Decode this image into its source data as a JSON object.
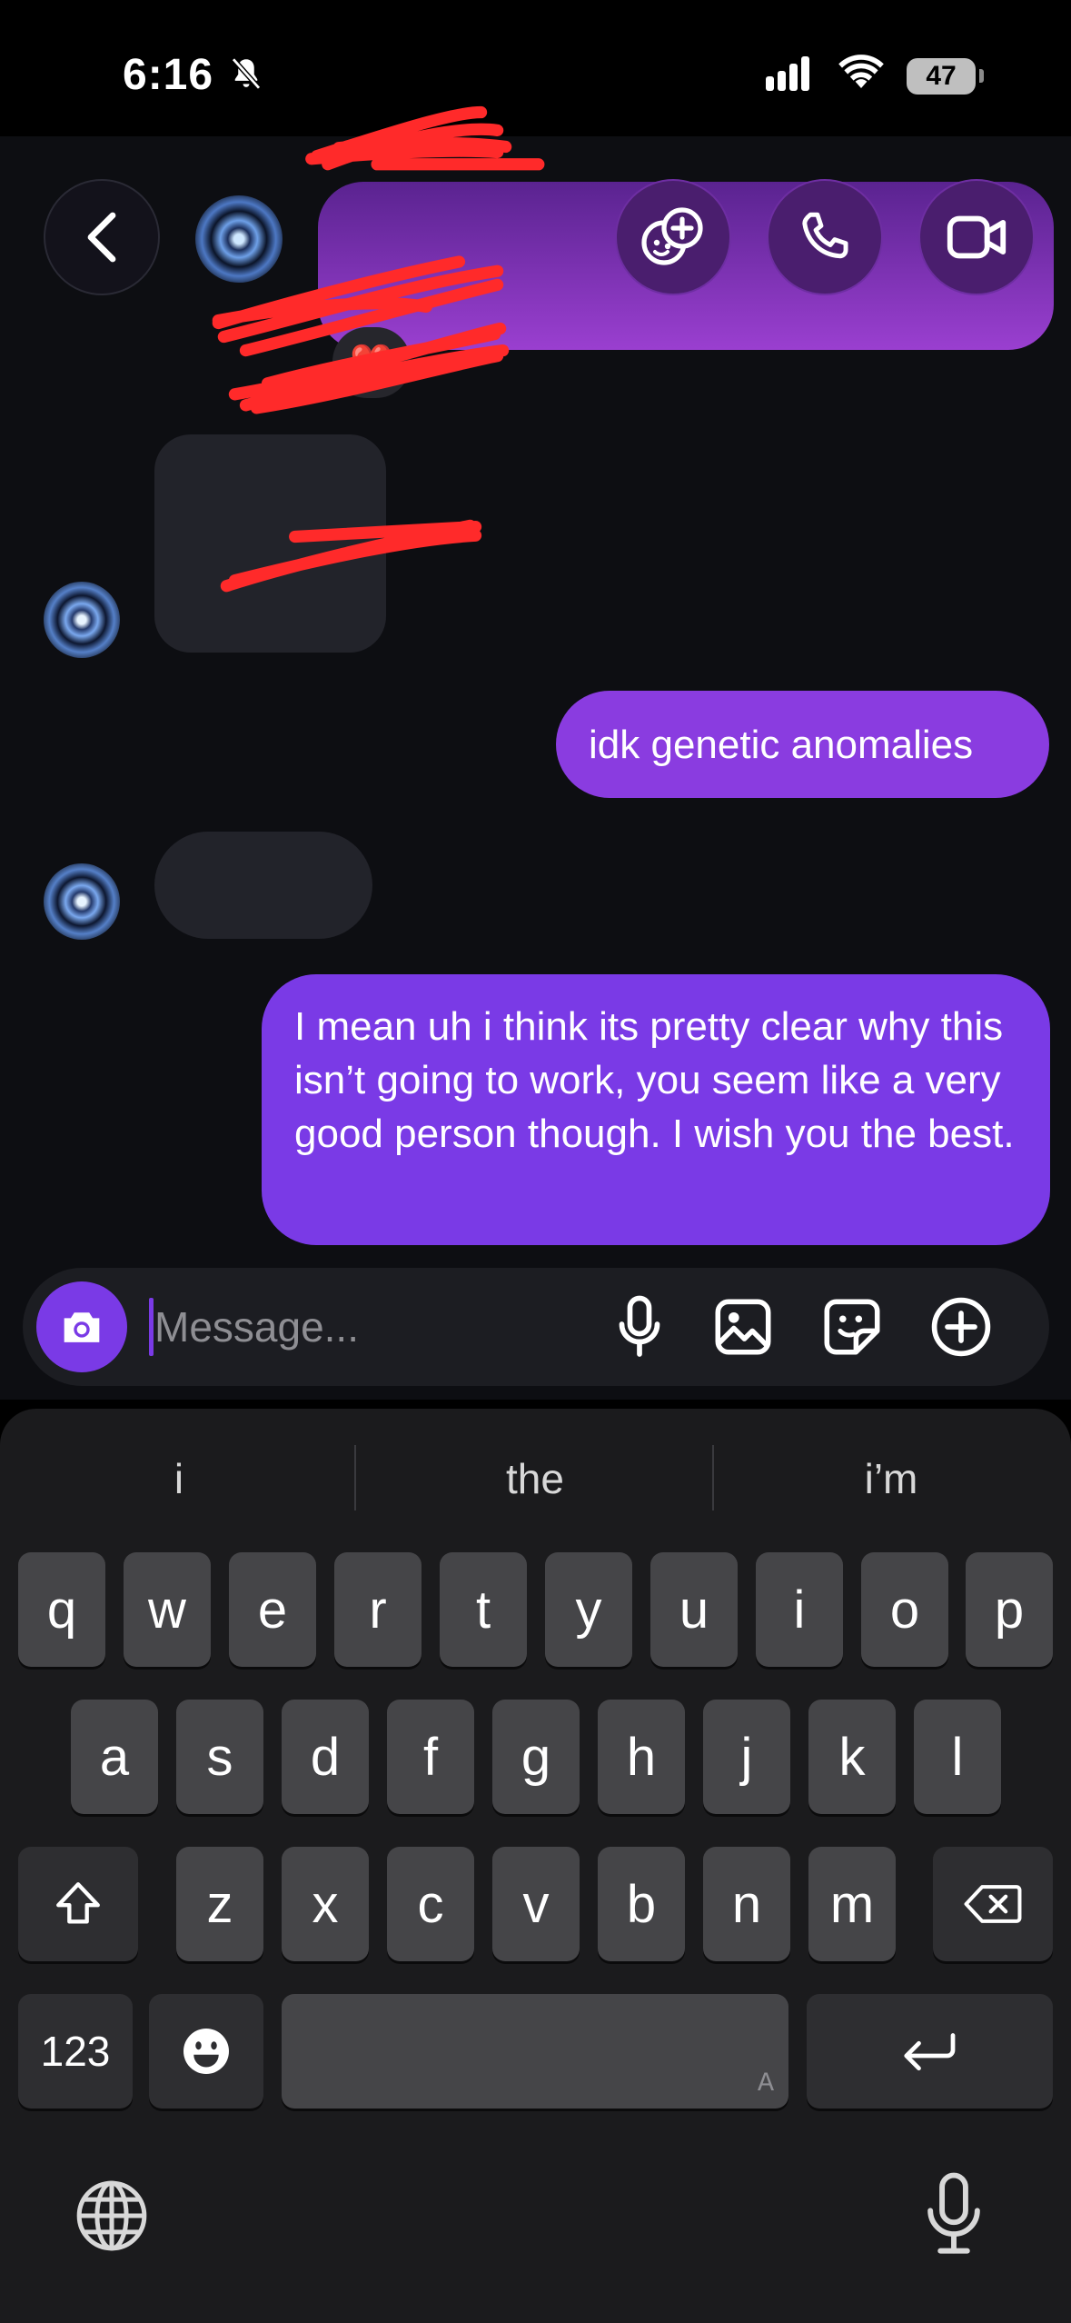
{
  "status_bar": {
    "time": "6:16",
    "battery": "47"
  },
  "header": {
    "back_icon": "chevron-left-icon",
    "effects_icon": "effects-face-plus-icon",
    "call_icon": "phone-icon",
    "video_icon": "video-camera-icon",
    "reaction": "❤️"
  },
  "messages": [
    {
      "direction": "outgoing",
      "text": "idk genetic anomalies"
    },
    {
      "direction": "outgoing",
      "text": "I mean uh i think its pretty clear why this isn’t going to work, you seem like a very good person though. I wish you the best."
    }
  ],
  "composer": {
    "placeholder": "Message...",
    "camera_icon": "camera-icon",
    "mic_icon": "microphone-icon",
    "gallery_icon": "image-icon",
    "sticker_icon": "sticker-icon",
    "plus_icon": "plus-circle-icon"
  },
  "keyboard": {
    "suggestions": [
      "i",
      "the",
      "i’m"
    ],
    "row1": [
      "q",
      "w",
      "e",
      "r",
      "t",
      "y",
      "u",
      "i",
      "o",
      "p"
    ],
    "row2": [
      "a",
      "s",
      "d",
      "f",
      "g",
      "h",
      "j",
      "k",
      "l"
    ],
    "row3": [
      "z",
      "x",
      "c",
      "v",
      "b",
      "n",
      "m"
    ],
    "numbers_label": "123",
    "space_hint": "A"
  },
  "colors": {
    "accent": "#7a3ae6",
    "bubble_outgoing": "#8a3ce0",
    "background": "#0d0e12",
    "keyboard_bg": "#1b1b1d",
    "key_bg": "#454548"
  }
}
